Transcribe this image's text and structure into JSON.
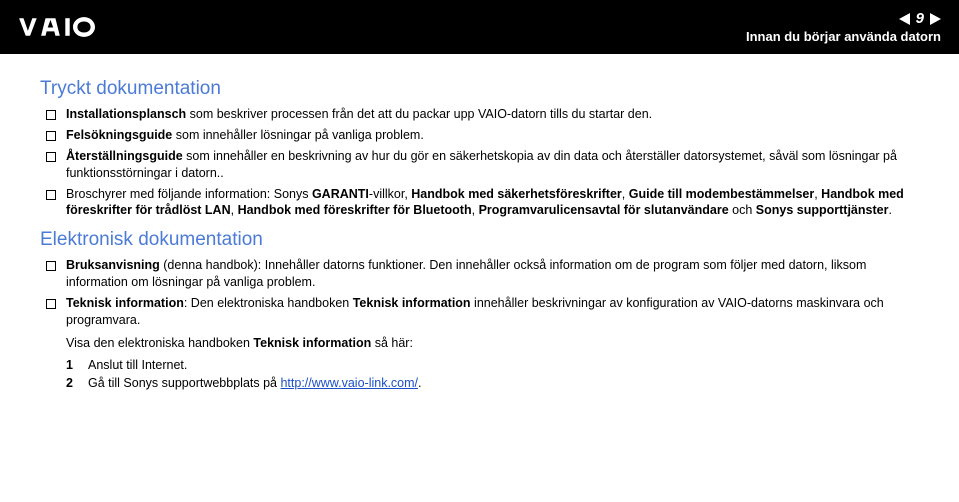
{
  "header": {
    "page_number": "9",
    "section": "Innan du börjar använda datorn"
  },
  "s1": {
    "title": "Tryckt dokumentation",
    "b1_bold": "Installationsplansch",
    "b1_rest": " som beskriver processen från det att du packar upp VAIO-datorn tills du startar den.",
    "b2_bold": "Felsökningsguide",
    "b2_rest": " som innehåller lösningar på vanliga problem.",
    "b3_bold": "Återställningsguide",
    "b3_rest": " som innehåller en beskrivning av hur du gör en säkerhetskopia av din data och återställer datorsystemet, såväl som lösningar på funktionsstörningar i datorn..",
    "b4_pre": "Broschyrer med följande information: Sonys ",
    "b4_t1": "GARANTI",
    "b4_sep1": "-villkor, ",
    "b4_t2": "Handbok med säkerhetsföreskrifter",
    "b4_sep2": ", ",
    "b4_t3": "Guide till modembestämmelser",
    "b4_sep3": ", ",
    "b4_t4": "Handbok med föreskrifter för trådlöst LAN",
    "b4_sep4": ", ",
    "b4_t5": "Handbok med föreskrifter för Bluetooth",
    "b4_sep5": ", ",
    "b4_t6": "Programvarulicensavtal för slutanvändare",
    "b4_sep6": " och ",
    "b4_t7": "Sonys supporttjänster",
    "b4_end": "."
  },
  "s2": {
    "title": "Elektronisk dokumentation",
    "b1_bold": "Bruksanvisning",
    "b1_rest": " (denna handbok): Innehåller datorns funktioner. Den innehåller också information om de program som följer med datorn, liksom information om lösningar på vanliga problem.",
    "b2_bold1": "Teknisk information",
    "b2_mid": ": Den elektroniska handboken ",
    "b2_bold2": "Teknisk information",
    "b2_rest": " innehåller beskrivningar av konfiguration av VAIO-datorns maskinvara och programvara.",
    "b2_line2_pre": "Visa den elektroniska handboken ",
    "b2_line2_bold": "Teknisk information",
    "b2_line2_post": " så här:",
    "step1": "Anslut till Internet.",
    "step2_pre": "Gå till Sonys supportwebbplats på ",
    "step2_link": "http://www.vaio-link.com/",
    "step2_post": "."
  }
}
